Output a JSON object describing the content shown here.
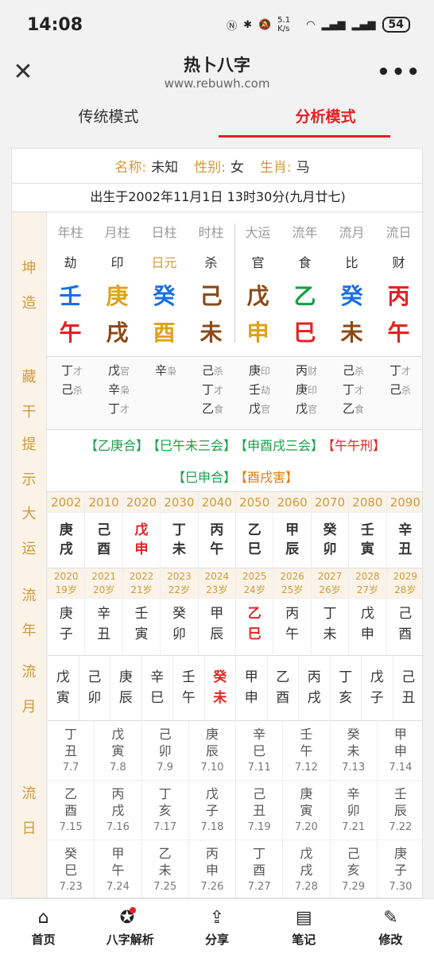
{
  "status": {
    "time": "14:08",
    "net_speed": "5.1 K/s",
    "battery": "54"
  },
  "titlebar": {
    "title": "热卜八字",
    "url": "www.rebuwh.com"
  },
  "tabs": [
    "传统模式",
    "分析模式"
  ],
  "info": {
    "name_label": "名称:",
    "name": "未知",
    "gender_label": "性别:",
    "gender": "女",
    "zodiac_label": "生肖:",
    "zodiac": "马",
    "birth": "出生于2002年11月1日 13时30分(九月廿七)"
  },
  "labels": {
    "kunzao": [
      "坤",
      "造"
    ],
    "canggan": [
      "藏",
      "干"
    ],
    "tishi": [
      "提",
      "示"
    ],
    "dayun": [
      "大",
      "运"
    ],
    "liunian": [
      "流",
      "年"
    ],
    "liuyue": [
      "流",
      "月"
    ],
    "liuri": [
      "流",
      "日"
    ]
  },
  "pillars": [
    {
      "head": "年柱",
      "ss": "劫",
      "gan": "壬",
      "gan_color": "#1a6fe0",
      "zhi": "午",
      "zhi_color": "#e52222"
    },
    {
      "head": "月柱",
      "ss": "印",
      "gan": "庚",
      "gan_color": "#e0a11a",
      "zhi": "戌",
      "zhi_color": "#8b4a16"
    },
    {
      "head": "日柱",
      "ss": "日元",
      "gan": "癸",
      "gan_color": "#1a6fe0",
      "zhi": "酉",
      "zhi_color": "#e0a11a"
    },
    {
      "head": "时柱",
      "ss": "杀",
      "gan": "己",
      "gan_color": "#8b4a16",
      "zhi": "未",
      "zhi_color": "#8b4a16"
    },
    {
      "head": "大运",
      "ss": "官",
      "gan": "戊",
      "gan_color": "#8b4a16",
      "zhi": "申",
      "zhi_color": "#e0a11a"
    },
    {
      "head": "流年",
      "ss": "食",
      "gan": "乙",
      "gan_color": "#18a048",
      "zhi": "巳",
      "zhi_color": "#e52222"
    },
    {
      "head": "流月",
      "ss": "比",
      "gan": "癸",
      "gan_color": "#1a6fe0",
      "zhi": "未",
      "zhi_color": "#8b4a16"
    },
    {
      "head": "流日",
      "ss": "财",
      "gan": "丙",
      "gan_color": "#e52222",
      "zhi": "午",
      "zhi_color": "#e52222"
    }
  ],
  "canggan": [
    [
      [
        "丁",
        "才"
      ],
      [
        "己",
        "杀"
      ]
    ],
    [
      [
        "戊",
        "官"
      ],
      [
        "辛",
        "枭"
      ],
      [
        "丁",
        "才"
      ]
    ],
    [
      [
        "辛",
        "枭"
      ]
    ],
    [
      [
        "己",
        "杀"
      ],
      [
        "丁",
        "才"
      ],
      [
        "乙",
        "食"
      ]
    ],
    [
      [
        "庚",
        "印"
      ],
      [
        "壬",
        "劫"
      ],
      [
        "戊",
        "官"
      ]
    ],
    [
      [
        "丙",
        "财"
      ],
      [
        "庚",
        "印"
      ],
      [
        "戊",
        "官"
      ]
    ],
    [
      [
        "己",
        "杀"
      ],
      [
        "丁",
        "才"
      ],
      [
        "乙",
        "食"
      ]
    ],
    [
      [
        "丁",
        "才"
      ],
      [
        "己",
        "杀"
      ]
    ]
  ],
  "tips": {
    "line1": [
      {
        "t": "【乙庚合】",
        "c": "#18a048"
      },
      {
        "t": "【巳午未三会】",
        "c": "#18a048"
      },
      {
        "t": "【申酉戌三会】",
        "c": "#18a048"
      },
      {
        "t": "【午午刑】",
        "c": "#e52222"
      }
    ],
    "line2": [
      {
        "t": "【巳申合】",
        "c": "#18a048"
      },
      {
        "t": "【酉戌害】",
        "c": "#e07a1a"
      }
    ]
  },
  "dayun": [
    {
      "year": "2002",
      "gz": [
        "庚",
        "戌"
      ],
      "red": false
    },
    {
      "year": "2010",
      "gz": [
        "己",
        "酉"
      ],
      "red": false
    },
    {
      "year": "2020",
      "gz": [
        "戊",
        "申"
      ],
      "red": true
    },
    {
      "year": "2030",
      "gz": [
        "丁",
        "未"
      ],
      "red": false
    },
    {
      "year": "2040",
      "gz": [
        "丙",
        "午"
      ],
      "red": false
    },
    {
      "year": "2050",
      "gz": [
        "乙",
        "巳"
      ],
      "red": false
    },
    {
      "year": "2060",
      "gz": [
        "甲",
        "辰"
      ],
      "red": false
    },
    {
      "year": "2070",
      "gz": [
        "癸",
        "卯"
      ],
      "red": false
    },
    {
      "year": "2080",
      "gz": [
        "壬",
        "寅"
      ],
      "red": false
    },
    {
      "year": "2090",
      "gz": [
        "辛",
        "丑"
      ],
      "red": false
    }
  ],
  "liunian": [
    {
      "year": "2020",
      "age": "19岁",
      "gz": [
        "庚",
        "子"
      ],
      "red": false
    },
    {
      "year": "2021",
      "age": "20岁",
      "gz": [
        "辛",
        "丑"
      ],
      "red": false
    },
    {
      "year": "2022",
      "age": "21岁",
      "gz": [
        "壬",
        "寅"
      ],
      "red": false
    },
    {
      "year": "2023",
      "age": "22岁",
      "gz": [
        "癸",
        "卯"
      ],
      "red": false
    },
    {
      "year": "2024",
      "age": "23岁",
      "gz": [
        "甲",
        "辰"
      ],
      "red": false
    },
    {
      "year": "2025",
      "age": "24岁",
      "gz": [
        "乙",
        "巳"
      ],
      "red": true
    },
    {
      "year": "2026",
      "age": "25岁",
      "gz": [
        "丙",
        "午"
      ],
      "red": false
    },
    {
      "year": "2027",
      "age": "26岁",
      "gz": [
        "丁",
        "未"
      ],
      "red": false
    },
    {
      "year": "2028",
      "age": "27岁",
      "gz": [
        "戊",
        "申"
      ],
      "red": false
    },
    {
      "year": "2029",
      "age": "28岁",
      "gz": [
        "己",
        "酉"
      ],
      "red": false
    }
  ],
  "liuyue": [
    {
      "gz": [
        "戊",
        "寅"
      ],
      "red": false
    },
    {
      "gz": [
        "己",
        "卯"
      ],
      "red": false
    },
    {
      "gz": [
        "庚",
        "辰"
      ],
      "red": false
    },
    {
      "gz": [
        "辛",
        "巳"
      ],
      "red": false
    },
    {
      "gz": [
        "壬",
        "午"
      ],
      "red": false
    },
    {
      "gz": [
        "癸",
        "未"
      ],
      "red": true
    },
    {
      "gz": [
        "甲",
        "申"
      ],
      "red": false
    },
    {
      "gz": [
        "乙",
        "酉"
      ],
      "red": false
    },
    {
      "gz": [
        "丙",
        "戌"
      ],
      "red": false
    },
    {
      "gz": [
        "丁",
        "亥"
      ],
      "red": false
    },
    {
      "gz": [
        "戊",
        "子"
      ],
      "red": false
    },
    {
      "gz": [
        "己",
        "丑"
      ],
      "red": false
    }
  ],
  "liuri": [
    {
      "gz": [
        "丁",
        "丑"
      ],
      "d": "7.7"
    },
    {
      "gz": [
        "戊",
        "寅"
      ],
      "d": "7.8"
    },
    {
      "gz": [
        "己",
        "卯"
      ],
      "d": "7.9"
    },
    {
      "gz": [
        "庚",
        "辰"
      ],
      "d": "7.10"
    },
    {
      "gz": [
        "辛",
        "巳"
      ],
      "d": "7.11"
    },
    {
      "gz": [
        "壬",
        "午"
      ],
      "d": "7.12"
    },
    {
      "gz": [
        "癸",
        "未"
      ],
      "d": "7.13"
    },
    {
      "gz": [
        "甲",
        "申"
      ],
      "d": "7.14"
    },
    {
      "gz": [
        "乙",
        "酉"
      ],
      "d": "7.15"
    },
    {
      "gz": [
        "丙",
        "戌"
      ],
      "d": "7.16"
    },
    {
      "gz": [
        "丁",
        "亥"
      ],
      "d": "7.17"
    },
    {
      "gz": [
        "戊",
        "子"
      ],
      "d": "7.18"
    },
    {
      "gz": [
        "己",
        "丑"
      ],
      "d": "7.19"
    },
    {
      "gz": [
        "庚",
        "寅"
      ],
      "d": "7.20"
    },
    {
      "gz": [
        "辛",
        "卯"
      ],
      "d": "7.21"
    },
    {
      "gz": [
        "壬",
        "辰"
      ],
      "d": "7.22"
    },
    {
      "gz": [
        "癸",
        "巳"
      ],
      "d": "7.23"
    },
    {
      "gz": [
        "甲",
        "午"
      ],
      "d": "7.24"
    },
    {
      "gz": [
        "乙",
        "未"
      ],
      "d": "7.25"
    },
    {
      "gz": [
        "丙",
        "申"
      ],
      "d": "7.26"
    },
    {
      "gz": [
        "丁",
        "酉"
      ],
      "d": "7.27"
    },
    {
      "gz": [
        "戊",
        "戌"
      ],
      "d": "7.28"
    },
    {
      "gz": [
        "己",
        "亥"
      ],
      "d": "7.29"
    },
    {
      "gz": [
        "庚",
        "子"
      ],
      "d": "7.30"
    }
  ],
  "nav": [
    {
      "label": "首页",
      "icon": "home-icon"
    },
    {
      "label": "八字解析",
      "icon": "bazi-star-icon"
    },
    {
      "label": "分享",
      "icon": "share-icon"
    },
    {
      "label": "笔记",
      "icon": "notes-icon"
    },
    {
      "label": "修改",
      "icon": "edit-icon"
    }
  ]
}
